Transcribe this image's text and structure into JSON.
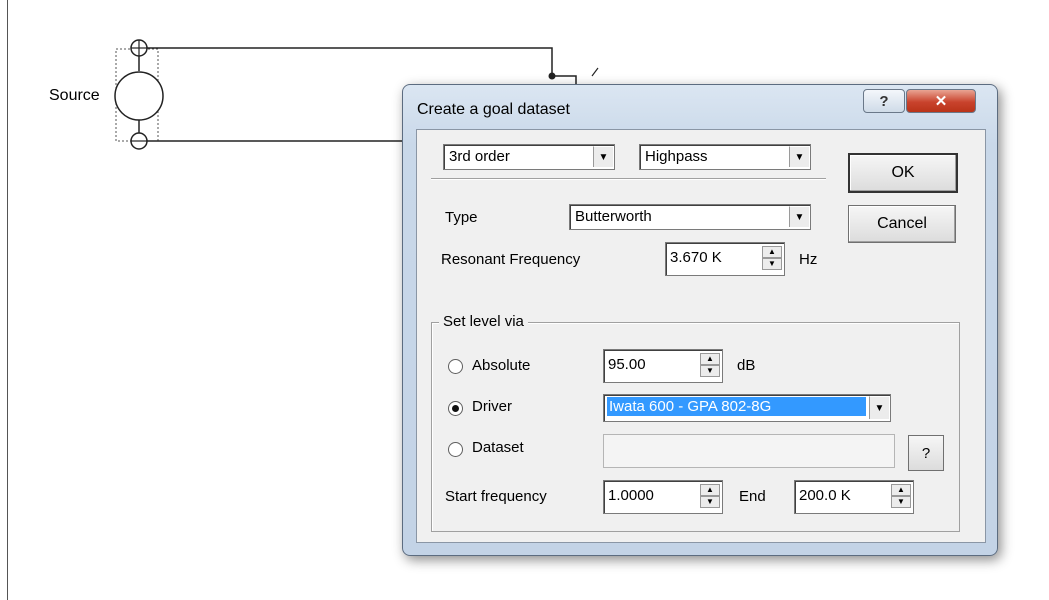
{
  "canvas": {
    "source_label": "Source"
  },
  "dialog": {
    "title": "Create a goal dataset",
    "help_glyph": "?",
    "close_glyph": "✕",
    "order_select": "3rd order",
    "filter_select": "Highpass",
    "ok_label": "OK",
    "cancel_label": "Cancel",
    "type_label": "Type",
    "type_select": "Butterworth",
    "resonant_label": "Resonant Frequency",
    "resonant_value": "3.670 K",
    "resonant_unit": "Hz",
    "group_title": "Set level via",
    "options": {
      "absolute_label": "Absolute",
      "absolute_value": "95.00",
      "absolute_unit": "dB",
      "driver_label": "Driver",
      "driver_value": "Iwata 600 - GPA 802-8G",
      "dataset_label": "Dataset",
      "dataset_button": "?",
      "selected": "Driver"
    },
    "start_label": "Start frequency",
    "start_value": "1.0000",
    "end_label": "End",
    "end_value": "200.0 K"
  },
  "colors": {
    "selection": "#3399ff",
    "close_button": "#c9432d"
  }
}
